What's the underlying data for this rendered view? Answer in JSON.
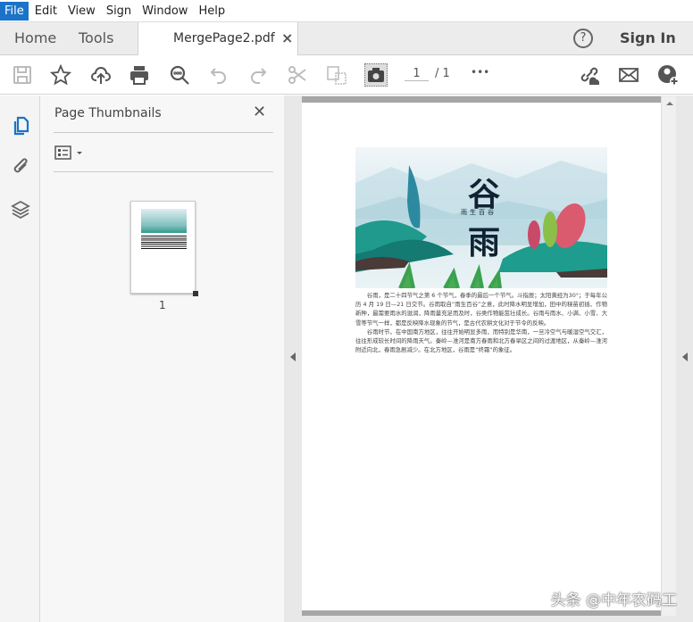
{
  "menu": [
    "File",
    "Edit",
    "View",
    "Sign",
    "Window",
    "Help"
  ],
  "tabs": {
    "home": "Home",
    "tools": "Tools",
    "document": "MergePage2.pdf",
    "close": "×",
    "help": "?",
    "sign_in": "Sign In"
  },
  "toolbar": {
    "page_current": "1",
    "page_total": "/ 1",
    "more": "•••",
    "icons": [
      "save-icon",
      "star-icon",
      "upload-cloud-icon",
      "print-icon",
      "zoom-search-icon",
      "undo-icon",
      "redo-icon",
      "cut-icon",
      "compare-icon",
      "snapshot-camera-icon",
      "share-link-icon",
      "email-icon",
      "add-user-icon"
    ]
  },
  "sidebar": {
    "icons": [
      "pages-icon",
      "attachment-icon",
      "layers-icon"
    ]
  },
  "panel": {
    "title": "Page Thumbnails",
    "close": "✕",
    "thumbnail_label": "1"
  },
  "document": {
    "art_title_top": "谷",
    "art_subtitle": "雨生百谷",
    "art_title_bottom": "雨",
    "paragraphs": [
      "谷雨，是二十四节气之第 6 个节气，春季的最后一个节气。斗指辰；太阳黄经为30°；于每年公历 4 月 19 日—21 日交节。谷雨取自“雨生百谷”之意，此时降水明显增加，田中的秧苗初插、作物新种，最需要雨水的滋润，降雨量充足而及时，谷类作物能茁壮成长。谷雨与雨水、小满、小雪、大雪等节气一样，都是反映降水现象的节气，是古代农耕文化对于节令的反映。",
      "谷雨时节，在中国南方地区，往往开始明显多雨，而特别是华南，一旦冷空气与暖湿空气交汇，往往形成较长时间的降雨天气。秦岭—淮河是南方春雨和北方春旱区之间的过渡地区，从秦岭—淮河附近向北，春雨急剧减少。在北方地区，谷雨是“终霜”的象征。"
    ]
  },
  "watermark": "头条 @中年农码工",
  "colors": {
    "accent": "#1a73c8",
    "tab_bar": "#ececec"
  }
}
